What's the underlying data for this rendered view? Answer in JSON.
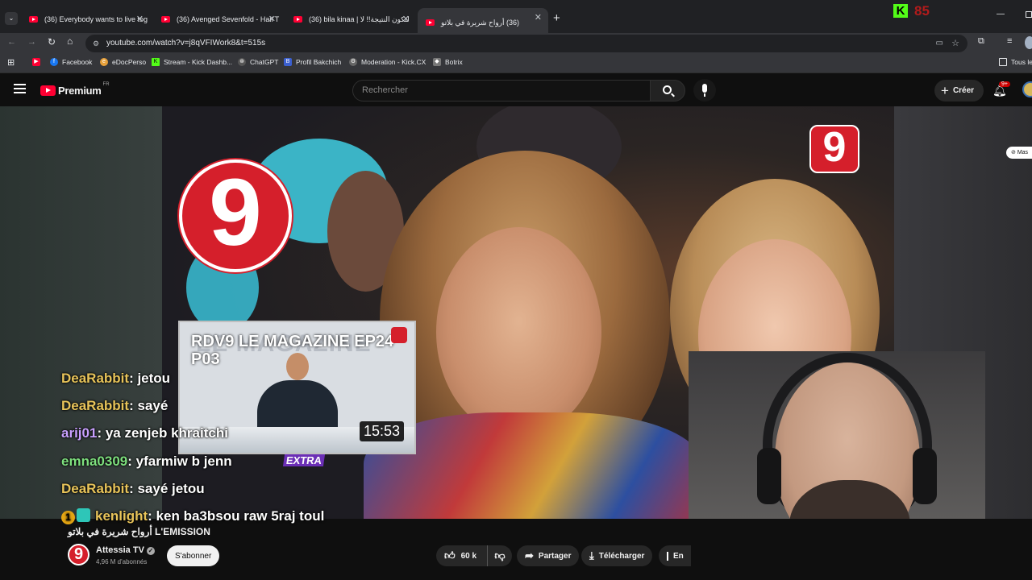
{
  "browser": {
    "tabs": [
      {
        "title": "(36) Everybody wants to live tog"
      },
      {
        "title": "(36) Avenged Sevenfold - Hail T"
      },
      {
        "title": "(36) bila kinaa | لتكون النتيجة!! لا"
      },
      {
        "title": "(36) أرواح شريرة في بلاتو"
      }
    ],
    "new_tab": "+",
    "kick_counter": "85",
    "url": "youtube.com/watch?v=j8qVFIWork8&t=515s",
    "bookmarks": [
      "Facebook",
      "eDocPerso",
      "Stream - Kick Dashb...",
      "ChatGPT",
      "Profil Bakchich",
      "Moderation - Kick.CX",
      "Botrix"
    ],
    "all_bookmarks": "Tous le"
  },
  "youtube": {
    "logo_text": "Premium",
    "logo_region": "FR",
    "search_placeholder": "Rechercher",
    "create_label": "Créer",
    "notif_badge": "9+",
    "masquer": "Mas"
  },
  "video": {
    "channel_badge": "9",
    "title": "أرواح شريرة في بلاتو L'EMISSION",
    "channel_name": "Attessia TV",
    "subscribers": "4,96 M d'abonnés",
    "subscribe_label": "S'abonner",
    "likes": "60 k",
    "share_label": "Partager",
    "download_label": "Télécharger",
    "more_label": "En"
  },
  "preview_card": {
    "title_line1": "RDV9 LE MAGAZINE EP24",
    "title_line2": "P03",
    "duration": "15:53",
    "tag": "EXTRA",
    "bg_text": "LE MAGAZINE"
  },
  "chat": [
    {
      "user": "DeaRabbit",
      "color": "#e8c45a",
      "msg": ": jetou"
    },
    {
      "user": "DeaRabbit",
      "color": "#e8c45a",
      "msg": ": sayé"
    },
    {
      "user": "arij01",
      "color": "#c9a0ff",
      "msg": ": ya zenjeb khraitchi"
    },
    {
      "user": "emna0309",
      "color": "#7ee07e",
      "msg": ": yfarmiw b jenn"
    },
    {
      "user": "DeaRabbit",
      "color": "#e8c45a",
      "msg": ": sayé jetou"
    },
    {
      "user": "kenlight",
      "color": "#e8c45a",
      "msg": ": ken ba3bsou raw 5raj toul",
      "badge": "1"
    }
  ]
}
